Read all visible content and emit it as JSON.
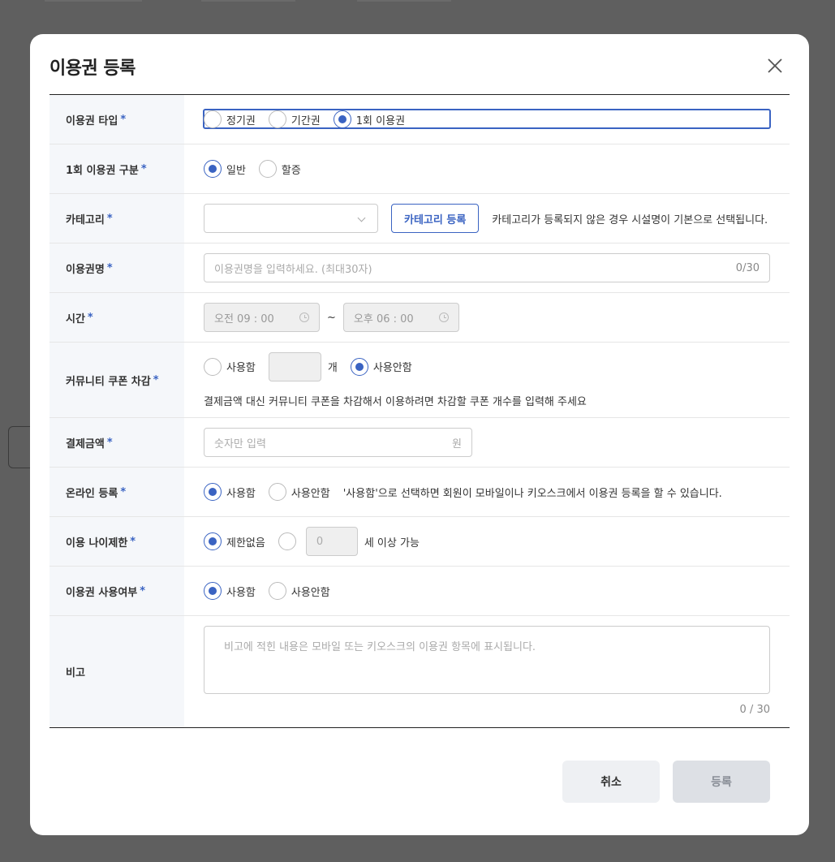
{
  "modal": {
    "title": "이용권 등록",
    "close_icon": "close-icon"
  },
  "form": {
    "ticket_type": {
      "label": "이용권 타입",
      "required": "*",
      "options": [
        "정기권",
        "기간권",
        "1회 이용권"
      ],
      "selected": "1회 이용권"
    },
    "single_category": {
      "label": "1회 이용권 구분",
      "required": "*",
      "options": [
        "일반",
        "할증"
      ],
      "selected": "일반"
    },
    "category": {
      "label": "카테고리",
      "required": "*",
      "select_value": "",
      "register_button": "카테고리 등록",
      "help": "카테고리가 등록되지 않은 경우 시설명이 기본으로 선택됩니다."
    },
    "ticket_name": {
      "label": "이용권명",
      "required": "*",
      "placeholder": "이용권명을 입력하세요. (최대30자)",
      "counter": "0/30"
    },
    "time": {
      "label": "시간",
      "required": "*",
      "start": "오전 09 : 00",
      "separator": "~",
      "end": "오후 06 : 00"
    },
    "community_coupon": {
      "label": "커뮤니티 쿠폰 차감",
      "required": "*",
      "use_label": "사용함",
      "count_value": "",
      "unit": "개",
      "not_use_label": "사용안함",
      "selected": "사용안함",
      "help": "결제금액 대신 커뮤니티 쿠폰을 차감해서 이용하려면 차감할 쿠폰 개수를 입력해 주세요"
    },
    "price": {
      "label": "결제금액",
      "required": "*",
      "placeholder": "숫자만 입력",
      "unit": "원"
    },
    "online": {
      "label": "온라인 등록",
      "required": "*",
      "options": [
        "사용함",
        "사용안함"
      ],
      "selected": "사용함",
      "help": "'사용함'으로 선택하면 회원이 모바일이나 키오스크에서 이용권 등록을 할 수 있습니다."
    },
    "age_limit": {
      "label": "이용 나이제한",
      "required": "*",
      "no_limit_label": "제한없음",
      "selected": "제한없음",
      "age_value": "0",
      "suffix": "세 이상 가능"
    },
    "usage": {
      "label": "이용권 사용여부",
      "required": "*",
      "options": [
        "사용함",
        "사용안함"
      ],
      "selected": "사용함"
    },
    "note": {
      "label": "비고",
      "placeholder": "비고에 적힌 내용은 모바일 또는 키오스크의 이용권 항목에 표시됩니다.",
      "counter": "0 / 30"
    }
  },
  "footer": {
    "cancel": "취소",
    "submit": "등록"
  },
  "colors": {
    "accent": "#3a63c2",
    "overlay": "#5f5f5f"
  }
}
